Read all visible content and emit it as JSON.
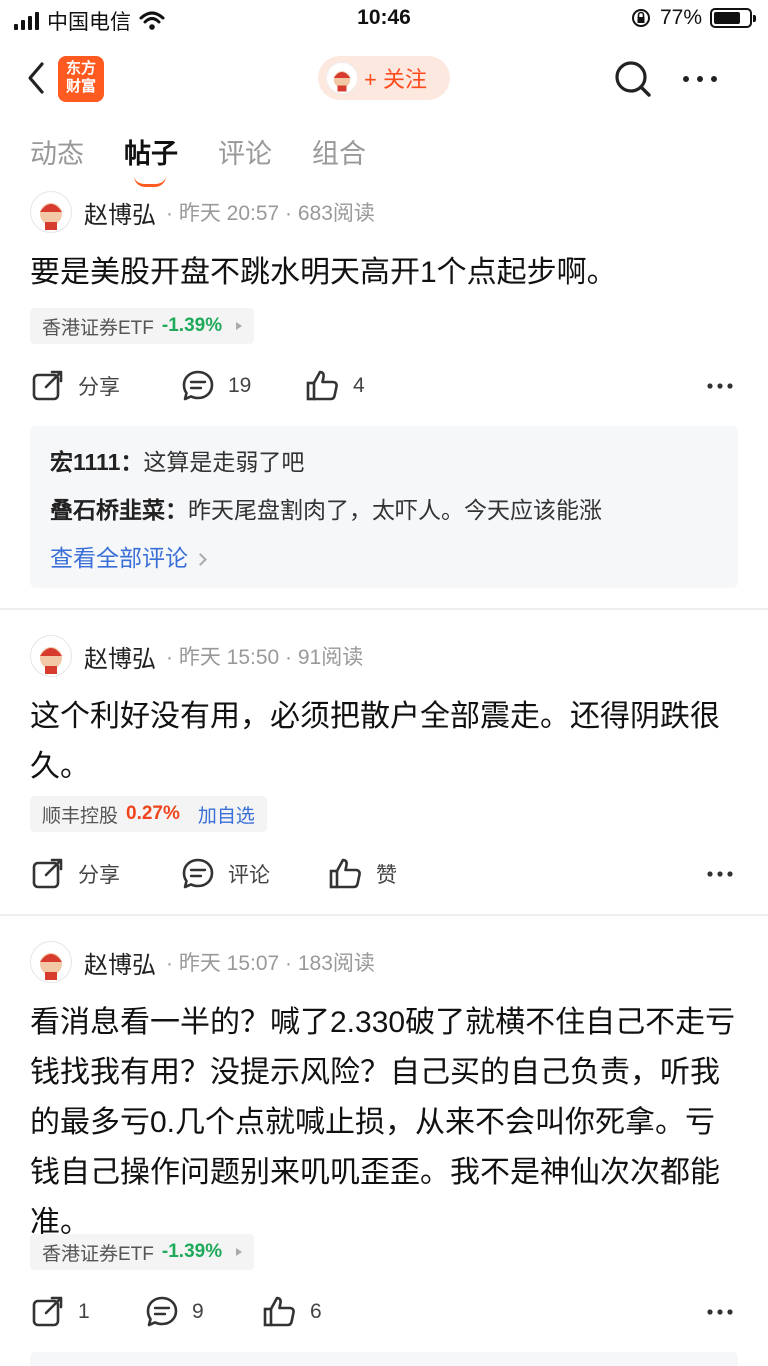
{
  "status_bar": {
    "carrier": "中国电信",
    "time": "10:46",
    "battery": "77%",
    "battery_level": 0.77
  },
  "nav": {
    "logo_line1": "东方",
    "logo_line2": "财富",
    "follow_label": "+ 关注"
  },
  "tabs": [
    {
      "label": "动态",
      "active": false
    },
    {
      "label": "帖子",
      "active": true
    },
    {
      "label": "评论",
      "active": false
    },
    {
      "label": "组合",
      "active": false
    }
  ],
  "posts": [
    {
      "author": "赵博弘",
      "meta": "· 昨天 20:57 · 683阅读",
      "text": "要是美股开盘不跳水明天高开1个点起步啊。",
      "stock": {
        "name": "香港证券ETF",
        "change": "-1.39%",
        "direction": "down"
      },
      "actions": {
        "share": "分享",
        "comment": "19",
        "like": "4"
      },
      "comments": [
        {
          "user": "宏1111：",
          "text": "这算是走弱了吧"
        },
        {
          "user": "叠石桥韭菜：",
          "text": "昨天尾盘割肉了，太吓人。今天应该能涨"
        }
      ],
      "view_all": "查看全部评论"
    },
    {
      "author": "赵博弘",
      "meta": "· 昨天 15:50 · 91阅读",
      "text": "这个利好没有用，必须把散户全部震走。还得阴跌很久。",
      "stock": {
        "name": "顺丰控股",
        "change": "0.27%",
        "direction": "up",
        "add_watch": "加自选"
      },
      "actions": {
        "share": "分享",
        "comment": "评论",
        "like": "赞"
      }
    },
    {
      "author": "赵博弘",
      "meta": "· 昨天 15:07 · 183阅读",
      "text": "看消息看一半的？喊了2.330破了就横不住自己不走亏钱找我有用？没提示风险？自己买的自己负责，听我的最多亏0.几个点就喊止损，从来不会叫你死拿。亏钱自己操作问题别来叽叽歪歪。我不是神仙次次都能准。",
      "stock": {
        "name": "香港证券ETF",
        "change": "-1.39%",
        "direction": "down"
      },
      "actions": {
        "share": "1",
        "comment": "9",
        "like": "6"
      }
    }
  ],
  "colors": {
    "brand": "#ff5a1f",
    "down": "#1faa5a",
    "up": "#f0451c",
    "link": "#3a6fd8"
  }
}
